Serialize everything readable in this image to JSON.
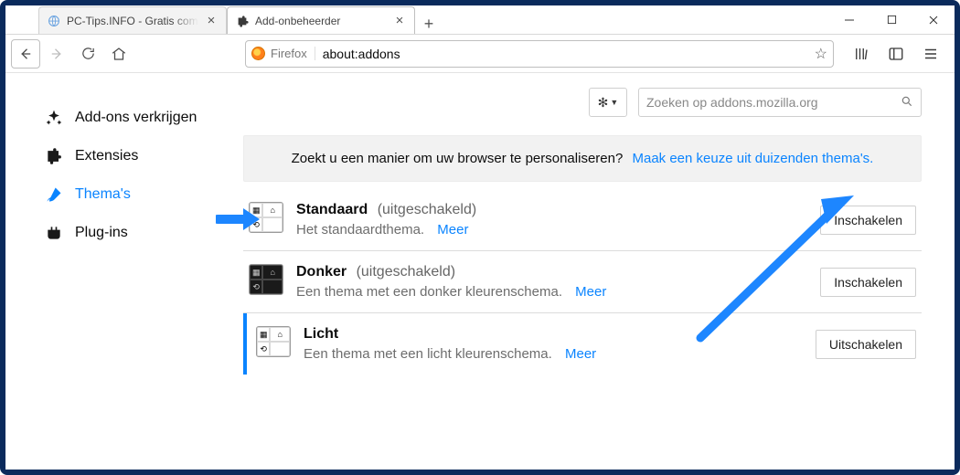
{
  "window": {
    "tabs": [
      {
        "title": "PC-Tips.INFO - Gratis computer tips",
        "active": false,
        "favicon": "globe"
      },
      {
        "title": "Add-onbeheerder",
        "active": true,
        "favicon": "puzzle"
      }
    ]
  },
  "toolbar": {
    "identity_label": "Firefox",
    "url": "about:addons"
  },
  "sidebar": {
    "items": [
      {
        "id": "get",
        "label": "Add-ons verkrijgen"
      },
      {
        "id": "extensions",
        "label": "Extensies"
      },
      {
        "id": "themes",
        "label": "Thema's"
      },
      {
        "id": "plugins",
        "label": "Plug-ins"
      }
    ],
    "active": "themes"
  },
  "main": {
    "search_placeholder": "Zoeken op addons.mozilla.org",
    "banner_text": "Zoekt u een manier om uw browser te personaliseren?",
    "banner_link": "Maak een keuze uit duizenden thema's.",
    "more_label": "Meer",
    "enable_label": "Inschakelen",
    "disable_label": "Uitschakelen",
    "disabled_state_label": "(uitgeschakeld)",
    "themes": [
      {
        "id": "default",
        "name": "Standaard",
        "desc": "Het standaardthema.",
        "active": false,
        "tone": "light"
      },
      {
        "id": "dark",
        "name": "Donker",
        "desc": "Een thema met een donker kleurenschema.",
        "active": false,
        "tone": "dark"
      },
      {
        "id": "light",
        "name": "Licht",
        "desc": "Een thema met een licht kleurenschema.",
        "active": true,
        "tone": "light"
      }
    ]
  }
}
